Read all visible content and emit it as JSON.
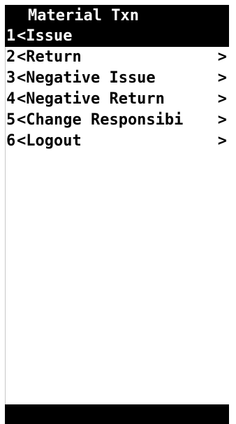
{
  "screen": {
    "title": "Material Txn"
  },
  "menu": {
    "items": [
      {
        "key": "1",
        "label": "<Issue",
        "arrow": ""
      },
      {
        "key": "2",
        "label": "<Return",
        "arrow": ">"
      },
      {
        "key": "3",
        "label": "<Negative Issue",
        "arrow": ">"
      },
      {
        "key": "4",
        "label": "<Negative Return",
        "arrow": ">"
      },
      {
        "key": "5",
        "label": "<Change Responsibi",
        "arrow": ">"
      },
      {
        "key": "6",
        "label": "<Logout",
        "arrow": ">"
      }
    ],
    "selected_index": 0
  },
  "colors": {
    "background": "#ffffff",
    "foreground": "#000000",
    "highlight": "#000000",
    "highlight_text": "#ffffff"
  }
}
